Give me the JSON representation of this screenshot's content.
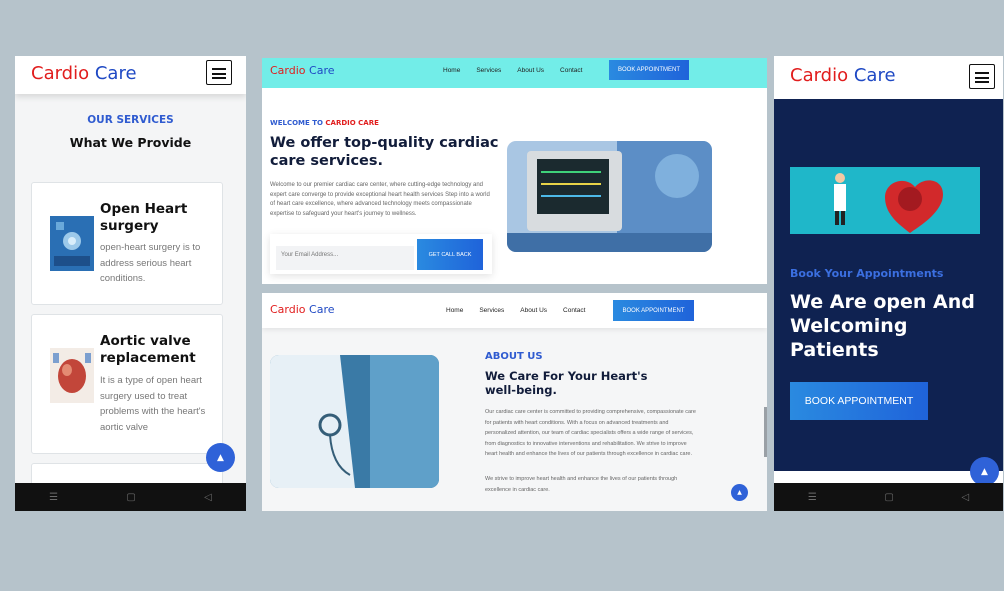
{
  "brand": {
    "part1": "Cardio",
    "part2": "Care"
  },
  "nav": {
    "home": "Home",
    "services": "Services",
    "about": "About Us",
    "contact": "Contact",
    "cta": "BOOK APPOINTMENT"
  },
  "services": {
    "eyebrow": "OUR SERVICES",
    "heading": "What We Provide",
    "cards": [
      {
        "title": "Open Heart surgery",
        "desc": "open-heart surgery is to address serious heart conditions."
      },
      {
        "title": "Aortic valve replacement",
        "desc": "It is a type of open heart surgery used to treat problems with the heart's aortic valve"
      }
    ]
  },
  "hero": {
    "welcome_prefix": "WELCOME TO",
    "welcome_brand": "CARDIO CARE",
    "heading": "We offer top-quality cardiac care services.",
    "paragraph": "Welcome to our premier cardiac care center, where cutting-edge technology and expert care converge to provide exceptional heart health services Step into a world of heart care excellence, where advanced technology meets compassionate expertise to safeguard your heart's journey to wellness.",
    "email_placeholder": "Your Email Address...",
    "callback_button": "GET CALL BACK"
  },
  "about": {
    "eyebrow": "ABOUT US",
    "heading": "We Care For Your Heart's well-being.",
    "paragraph1": "Our cardiac care center is committed to providing comprehensive, compassionate care for patients with heart conditions. With a focus on advanced treatments and personalized attention, our team of cardiac specialists offers a wide range of services, from diagnostics to innovative interventions and rehabilitation. We strive to improve heart health and enhance the lives of our patients through excellence in cardiac care.",
    "paragraph2": "We strive to improve heart health and enhance the lives of our patients through excellence in cardiac care."
  },
  "appointment": {
    "eyebrow": "Book Your Appointments",
    "heading": "We Are open And Welcoming Patients",
    "button": "BOOK APPOINTMENT"
  },
  "colors": {
    "brand_red": "#e11d1d",
    "brand_blue": "#1f49c4",
    "navy": "#0f2251",
    "cyan_header": "#72ede8",
    "accent_blue": "#2f62d8",
    "light_blue_text": "#3b6fe0"
  },
  "icons": {
    "menu": "hamburger-menu-icon",
    "scroll_top": "arrow-up-icon",
    "android_nav": [
      "recents-icon",
      "home-icon",
      "back-icon"
    ]
  }
}
